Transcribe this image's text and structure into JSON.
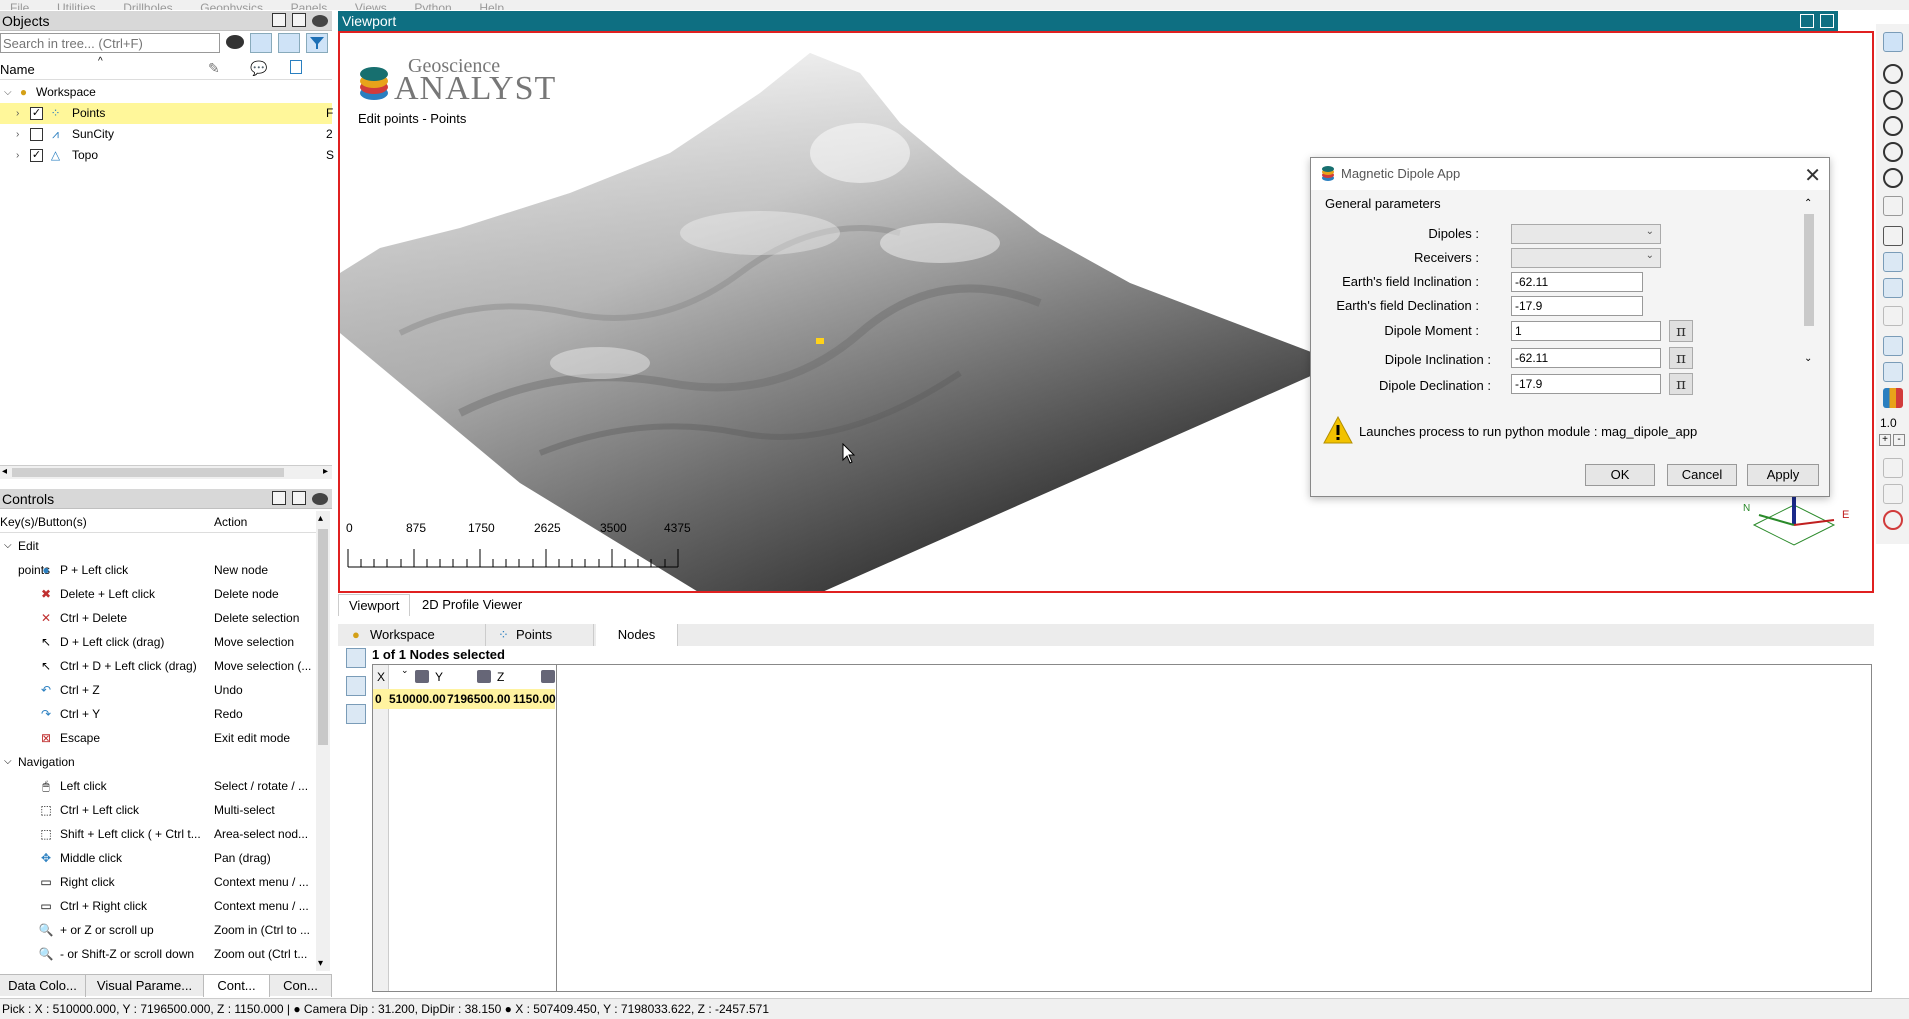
{
  "menu": [
    "File",
    "Utilities",
    "Drillholes",
    "Geophysics",
    "Panels",
    "Views",
    "Python",
    "Help"
  ],
  "objects_panel": {
    "title": "Objects",
    "search_placeholder": "Search in tree... (Ctrl+F)",
    "column_name": "Name",
    "tree": [
      {
        "label": "Workspace",
        "checked": null,
        "selected": false
      },
      {
        "label": "Points",
        "checked": true,
        "selected": true,
        "extra": "F"
      },
      {
        "label": "SunCity",
        "checked": false,
        "selected": false,
        "extra": "2"
      },
      {
        "label": "Topo",
        "checked": true,
        "selected": false,
        "extra": "S"
      }
    ]
  },
  "controls_panel": {
    "title": "Controls",
    "col_key": "Key(s)/Button(s)",
    "col_action": "Action",
    "groups": [
      {
        "label": "Edit points",
        "rows": [
          {
            "key": "P + Left click",
            "action": "New node",
            "icon": "add-node-icon"
          },
          {
            "key": "Delete + Left click",
            "action": "Delete node",
            "icon": "delete-node-icon"
          },
          {
            "key": "Ctrl + Delete",
            "action": "Delete selection",
            "icon": "delete-selection-icon"
          },
          {
            "key": "D + Left click (drag)",
            "action": "Move selection",
            "icon": "move-icon"
          },
          {
            "key": "Ctrl + D + Left click (drag)",
            "action": "Move selection (...",
            "icon": "move-icon"
          },
          {
            "key": "Ctrl + Z",
            "action": "Undo",
            "icon": "undo-icon"
          },
          {
            "key": "Ctrl + Y",
            "action": "Redo",
            "icon": "redo-icon"
          },
          {
            "key": "Escape",
            "action": "Exit edit mode",
            "icon": "exit-icon"
          }
        ]
      },
      {
        "label": "Navigation",
        "rows": [
          {
            "key": "Left click",
            "action": "Select / rotate / ...",
            "icon": "mouse-left-icon"
          },
          {
            "key": "Ctrl + Left click",
            "action": "Multi-select",
            "icon": "multi-select-icon"
          },
          {
            "key": "Shift + Left click ( + Ctrl t...",
            "action": "Area-select nod...",
            "icon": "area-select-icon"
          },
          {
            "key": "Middle click",
            "action": "Pan (drag)",
            "icon": "pan-icon"
          },
          {
            "key": "Right click",
            "action": "Context menu / ...",
            "icon": "mouse-right-icon"
          },
          {
            "key": "Ctrl + Right click",
            "action": "Context menu / ...",
            "icon": "mouse-right-icon"
          },
          {
            "key": "+ or Z or scroll up",
            "action": "Zoom in (Ctrl to ...",
            "icon": "zoom-in-icon"
          },
          {
            "key": "- or Shift-Z or scroll down",
            "action": "Zoom out (Ctrl t...",
            "icon": "zoom-out-icon"
          }
        ]
      }
    ],
    "bottom_tabs": [
      "Data Colo...",
      "Visual Parame...",
      "Cont...",
      "Con..."
    ]
  },
  "viewport": {
    "title": "Viewport",
    "logo_line1": "Geoscience",
    "logo_line2": "ANALYST",
    "edit_status": "Edit points - Points",
    "scale_labels": [
      "0",
      "875",
      "1750",
      "2625",
      "3500",
      "4375"
    ],
    "compass_n": "N",
    "compass_e": "E",
    "zoom_value": "1.0"
  },
  "dialog": {
    "title": "Magnetic Dipole App",
    "group_title": "General parameters",
    "fields": [
      {
        "label": "Dipoles :",
        "type": "combo",
        "value": ""
      },
      {
        "label": "Receivers :",
        "type": "combo",
        "value": ""
      },
      {
        "label": "Earth's field Inclination :",
        "type": "text",
        "value": "-62.11"
      },
      {
        "label": "Earth's field Declination :",
        "type": "text",
        "value": "-17.9"
      },
      {
        "label": "Dipole Moment :",
        "type": "text_pi",
        "value": "1"
      },
      {
        "label": "Dipole Inclination :",
        "type": "text_pi",
        "value": "-62.11"
      },
      {
        "label": "Dipole Declination :",
        "type": "text_pi",
        "value": "-17.9"
      }
    ],
    "pi_symbol": "π",
    "warning": "Launches process to run python module : mag_dipole_app",
    "ok": "OK",
    "cancel": "Cancel",
    "apply": "Apply"
  },
  "view_tabs": [
    "Viewport",
    "2D Profile Viewer"
  ],
  "data_tabs": [
    "Workspace",
    "Points",
    "Nodes"
  ],
  "nodes": {
    "selected_text": "1 of 1 Nodes selected",
    "columns": [
      "X",
      "Y",
      "Z"
    ],
    "rows": [
      {
        "index": "0",
        "x": "510000.00",
        "y": "7196500.00",
        "z": "1150.00"
      }
    ]
  },
  "statusbar": "Pick : X : 510000.000, Y : 7196500.000, Z : 1150.000 |  ● Camera Dip : 31.200, DipDir : 38.150  ● X : 507409.450, Y : 7198033.622, Z : -2457.571",
  "colors": {
    "accent": "#0e6f82",
    "selection": "#fff3a0",
    "viewport_border": "#e02020"
  }
}
